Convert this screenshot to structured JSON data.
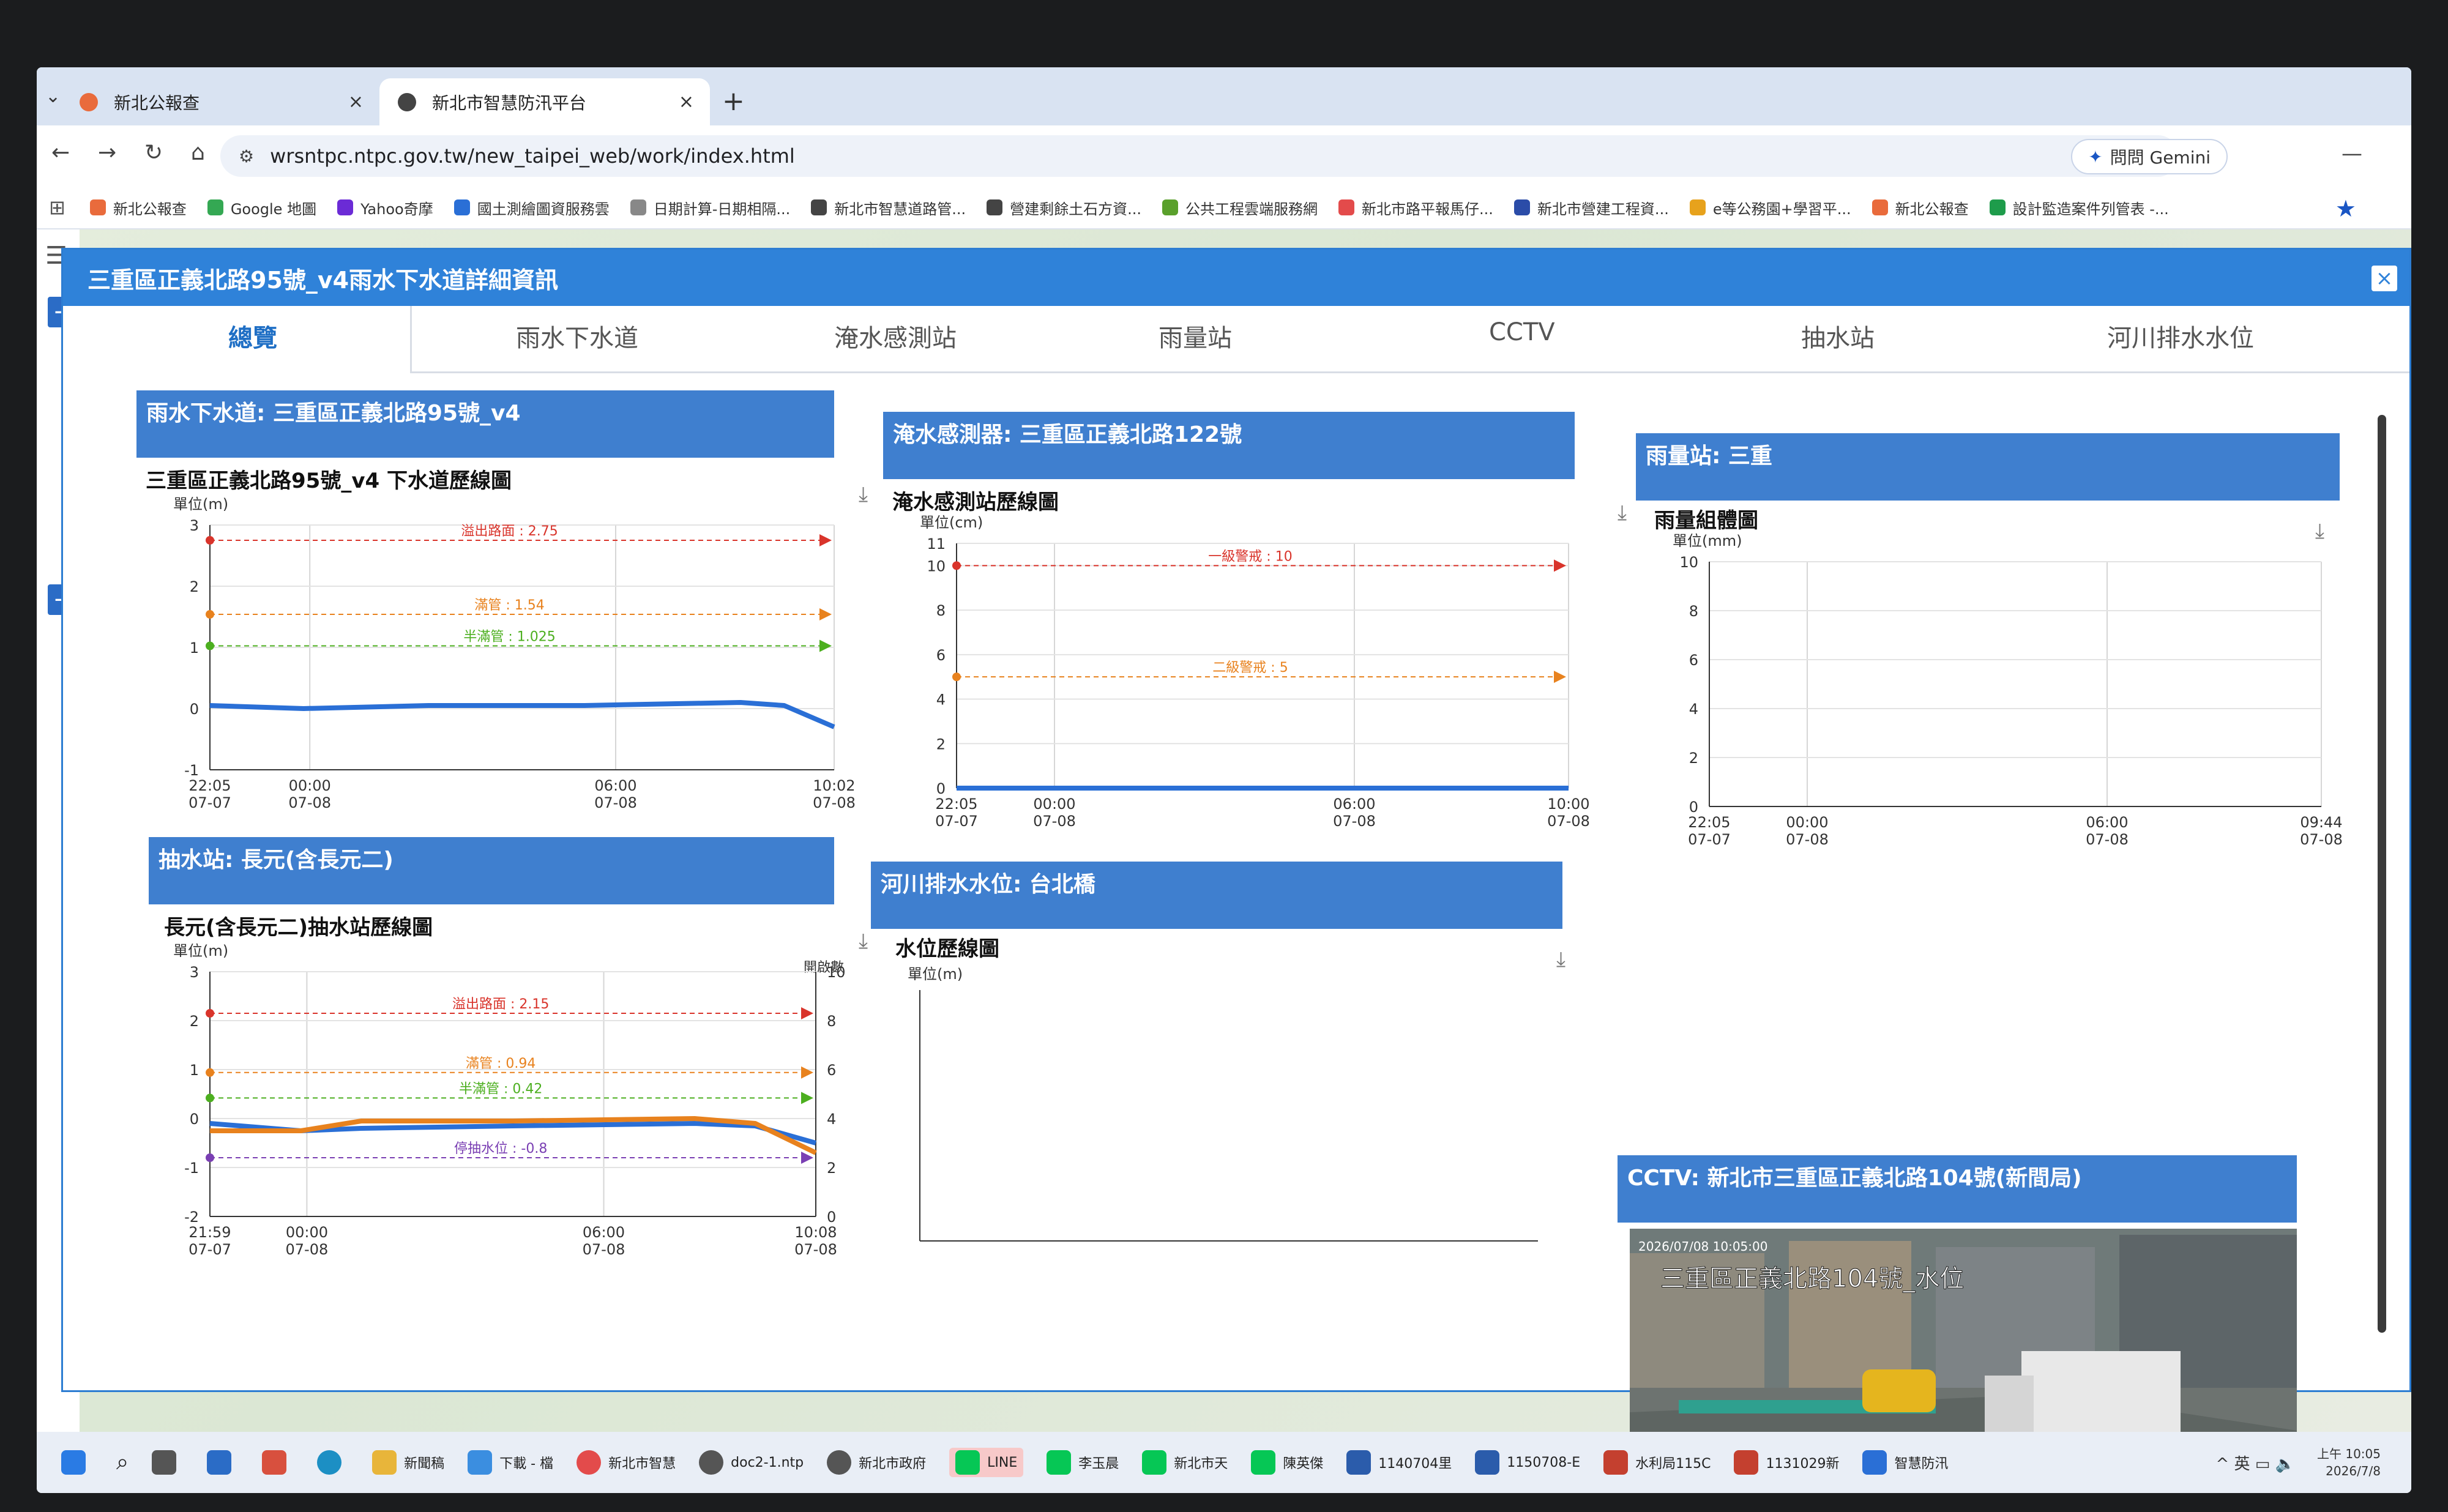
{
  "browser": {
    "tabs": [
      {
        "label": "新北公報查"
      },
      {
        "label": "新北市智慧防汛平台"
      }
    ],
    "new_tab": "+",
    "url": "wrsntpc.ntpc.gov.tw/new_taipei_web/work/index.html",
    "gemini_label": "問問 Gemini",
    "bookmarks": [
      "新北公報查",
      "Google 地圖",
      "Yahoo奇摩",
      "國土測繪圖資服務雲",
      "日期計算-日期相隔...",
      "新北市智慧道路管...",
      "營建剩餘土石方資...",
      "公共工程雲端服務網",
      "新北市路平報馬仔...",
      "新北市營建工程資...",
      "e等公務園+學習平...",
      "新北公報查",
      "設計監造案件列管表 -..."
    ]
  },
  "dialog": {
    "title": "三重區正義北路95號_v4雨水下水道詳細資訊",
    "tabs": [
      "總覽",
      "雨水下水道",
      "淹水感測站",
      "雨量站",
      "CCTV",
      "抽水站",
      "河川排水水位"
    ]
  },
  "panels": {
    "sewer": {
      "header": "雨水下水道: 三重區正義北路95號_v4",
      "title": "三重區正義北路95號_v4 下水道歷線圖",
      "unit": "單位(m)"
    },
    "flood": {
      "header": "淹水感測器: 三重區正義北路122號",
      "title": "淹水感測站歷線圖",
      "unit": "單位(cm)"
    },
    "rain": {
      "header": "雨量站: 三重",
      "title": "雨量組體圖",
      "unit": "單位(mm)"
    },
    "pump": {
      "header": "抽水站: 長元(含長元二)",
      "title": "長元(含長元二)抽水站歷線圖",
      "unit": "單位(m)",
      "unit_right": "開啟數"
    },
    "river": {
      "header": "河川排水水位: 台北橋",
      "title": "水位歷線圖",
      "unit": "單位(m)"
    },
    "cctv": {
      "header": "CCTV: 新北市三重區正義北路104號(新間局)",
      "overlay": "三重區正義北路104號_水位",
      "timestamp": "2026/07/08 10:05:00"
    }
  },
  "chart_data": [
    {
      "id": "sewer",
      "type": "line",
      "ylim": [
        -1,
        3
      ],
      "yticks": [
        -1,
        0,
        1,
        2,
        3
      ],
      "xticks": [
        [
          "22:05",
          "07-07"
        ],
        [
          "00:00",
          "07-08"
        ],
        [
          "06:00",
          "07-08"
        ],
        [
          "10:02",
          "07-08"
        ]
      ],
      "reference_lines": [
        {
          "label": "溢出路面 : 2.75",
          "value": 2.75,
          "color": "#d9342b"
        },
        {
          "label": "滿管 : 1.54",
          "value": 1.54,
          "color": "#e8821e"
        },
        {
          "label": "半滿管 : 1.025",
          "value": 1.025,
          "color": "#4caf1f"
        }
      ],
      "series": [
        {
          "color": "#2a6fd6",
          "x": [
            0,
            0.15,
            0.35,
            0.6,
            0.85,
            0.92,
            1.0
          ],
          "values": [
            0.05,
            0.0,
            0.05,
            0.05,
            0.1,
            0.05,
            -0.3
          ]
        }
      ]
    },
    {
      "id": "flood",
      "type": "line",
      "ylim": [
        0,
        11
      ],
      "yticks": [
        0,
        2,
        4,
        6,
        8,
        10,
        11
      ],
      "xticks": [
        [
          "22:05",
          "07-07"
        ],
        [
          "00:00",
          "07-08"
        ],
        [
          "06:00",
          "07-08"
        ],
        [
          "10:00",
          "07-08"
        ]
      ],
      "reference_lines": [
        {
          "label": "一級警戒 : 10",
          "value": 10,
          "color": "#d9342b"
        },
        {
          "label": "二級警戒 : 5",
          "value": 5,
          "color": "#e8821e"
        }
      ],
      "series": [
        {
          "color": "#2a6fd6",
          "x": [
            0,
            1
          ],
          "values": [
            0,
            0
          ]
        }
      ]
    },
    {
      "id": "rain",
      "type": "bar",
      "ylim": [
        0,
        10
      ],
      "yticks": [
        0,
        2,
        4,
        6,
        8,
        10
      ],
      "xticks": [
        [
          "22:05",
          "07-07"
        ],
        [
          "00:00",
          "07-08"
        ],
        [
          "06:00",
          "07-08"
        ],
        [
          "09:44",
          "07-08"
        ]
      ],
      "values": []
    },
    {
      "id": "pump",
      "type": "line",
      "ylim": [
        -2,
        3
      ],
      "yticks": [
        -2,
        -1,
        0,
        1,
        2,
        3
      ],
      "y2lim": [
        0,
        10
      ],
      "y2ticks": [
        0,
        2,
        4,
        6,
        8,
        10
      ],
      "xticks": [
        [
          "21:59",
          "07-07"
        ],
        [
          "00:00",
          "07-08"
        ],
        [
          "06:00",
          "07-08"
        ],
        [
          "10:08",
          "07-08"
        ]
      ],
      "reference_lines": [
        {
          "label": "溢出路面 : 2.15",
          "value": 2.15,
          "color": "#d9342b"
        },
        {
          "label": "滿管 : 0.94",
          "value": 0.94,
          "color": "#e8821e"
        },
        {
          "label": "半滿管 : 0.42",
          "value": 0.42,
          "color": "#4caf1f"
        },
        {
          "label": "停抽水位 : -0.8",
          "value": -0.8,
          "color": "#7a3fb3"
        }
      ],
      "series": [
        {
          "color": "#2a6fd6",
          "x": [
            0,
            0.15,
            0.25,
            0.5,
            0.8,
            0.9,
            1.0
          ],
          "values": [
            -0.1,
            -0.25,
            -0.2,
            -0.15,
            -0.1,
            -0.15,
            -0.5
          ]
        },
        {
          "color": "#e8821e",
          "x": [
            0,
            0.15,
            0.25,
            0.5,
            0.8,
            0.9,
            1.0
          ],
          "values": [
            -0.25,
            -0.25,
            -0.05,
            -0.05,
            0.0,
            -0.1,
            -0.7
          ]
        }
      ]
    },
    {
      "id": "river",
      "type": "line",
      "ylim": [
        0,
        1
      ],
      "yticks": [],
      "xticks": [],
      "series": []
    }
  ],
  "taskbar": {
    "apps": [
      "新聞稿",
      "下載 - 檔",
      "新北市智慧",
      "doc2-1.ntp",
      "新北市政府",
      "LINE",
      "李玉晨",
      "新北市天",
      "陳英傑",
      "1140704里",
      "1150708-E",
      "水利局115C",
      "1131029新",
      "智慧防汛"
    ],
    "time": "上午 10:05",
    "date": "2026/7/8"
  }
}
